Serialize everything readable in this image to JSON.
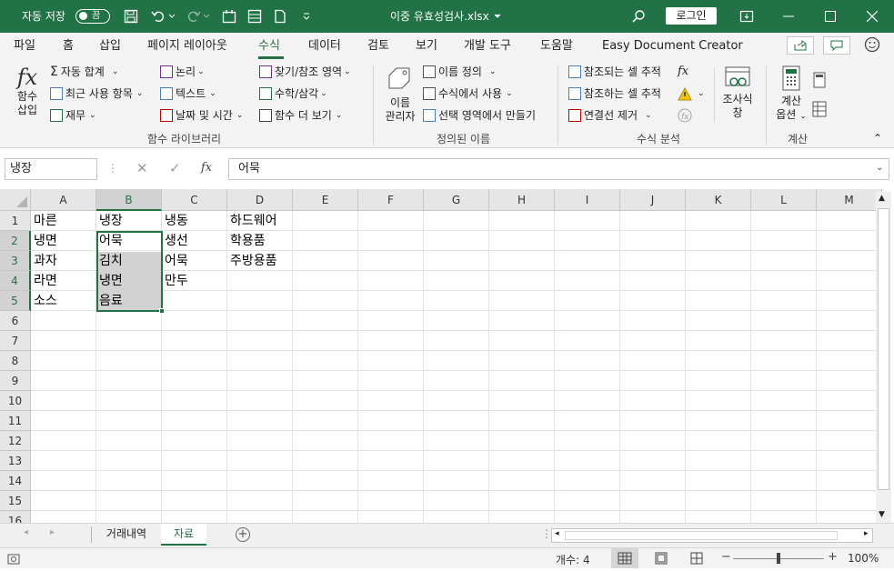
{
  "titlebar": {
    "autosave_label": "자동 저장",
    "autosave_state": "끔",
    "filename": "이중 유효성검사.xlsx",
    "login": "로그인"
  },
  "menu": {
    "tabs": [
      "파일",
      "홈",
      "삽입",
      "페이지 레이아웃",
      "수식",
      "데이터",
      "검토",
      "보기",
      "개발 도구",
      "도움말",
      "Easy Document Creator"
    ],
    "active": "수식"
  },
  "ribbon": {
    "insert_function": [
      "함수",
      "삽입"
    ],
    "autosum": "자동 합계",
    "recent": "최근 사용 항목",
    "financial": "재무",
    "logical": "논리",
    "text": "텍스트",
    "datetime": "날짜 및 시간",
    "lookup": "찾기/참조 영역",
    "math": "수학/삼각",
    "more": "함수 더 보기",
    "group_library": "함수 라이브러리",
    "name_manager": [
      "이름",
      "관리자"
    ],
    "define_name": "이름 정의",
    "use_in_formula": "수식에서 사용",
    "create_from_selection": "선택 영역에서 만들기",
    "group_defined": "정의된 이름",
    "trace_precedents": "참조되는 셀 추적",
    "trace_dependents": "참조하는 셀 추적",
    "remove_arrows": "연결선 제거",
    "group_audit": "수식 분석",
    "watch_window": [
      "조사식",
      "창"
    ],
    "calc_options": [
      "계산",
      "옵션"
    ],
    "group_calc": "계산"
  },
  "formula_bar": {
    "name_box": "냉장",
    "content": "어묵",
    "fx_label": "fx"
  },
  "grid": {
    "columns": [
      "A",
      "B",
      "C",
      "D",
      "E",
      "F",
      "G",
      "H",
      "I",
      "J",
      "K",
      "L",
      "M"
    ],
    "rows": [
      "1",
      "2",
      "3",
      "4",
      "5",
      "6",
      "7",
      "8",
      "9",
      "10",
      "11",
      "12",
      "13",
      "14",
      "15",
      "16"
    ],
    "cells": {
      "A": [
        "마른",
        "냉면",
        "과자",
        "라면",
        "소스"
      ],
      "B": [
        "냉장",
        "어묵",
        "김치",
        "냉면",
        "음료"
      ],
      "C": [
        "냉동",
        "생선",
        "어묵",
        "만두"
      ],
      "D": [
        "하드웨어",
        "학용품",
        "주방용품"
      ]
    }
  },
  "sheets": {
    "tabs": [
      "거래내역",
      "자료"
    ],
    "active": "자료"
  },
  "status": {
    "count": "개수: 4",
    "zoom": "100%"
  },
  "colors": {
    "accent": "#217346",
    "selection_fill": "#d2d2d2"
  }
}
